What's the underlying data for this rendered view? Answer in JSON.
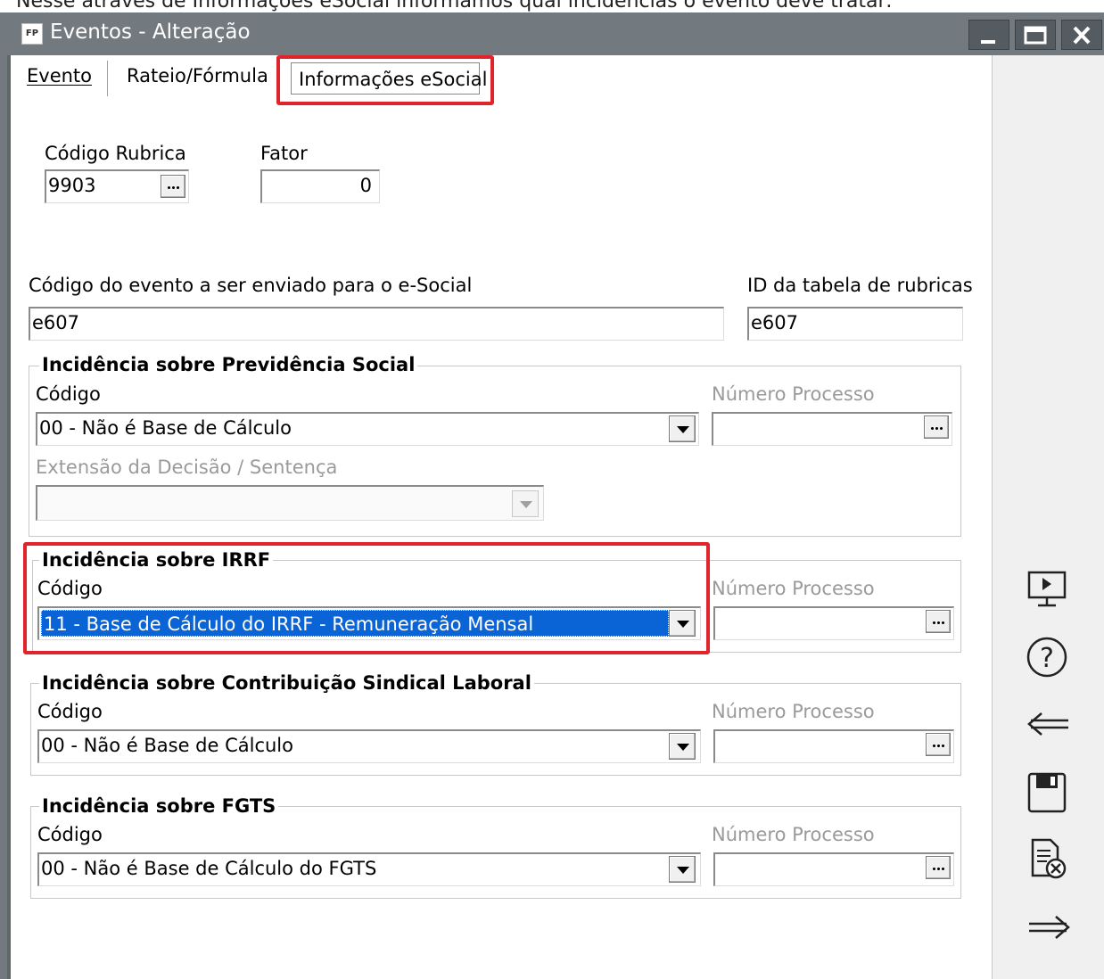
{
  "window": {
    "title": "Eventos - Alteração",
    "app_icon_text": "FP",
    "top_caption": "Nesse através de Informações eSocial informamos qual incidências o evento deve tratar:"
  },
  "tabs": [
    {
      "label": "Evento",
      "underline": "E"
    },
    {
      "label": "Rateio/Fórmula"
    },
    {
      "label": "Informações eSocial",
      "active": true
    }
  ],
  "rubrica": {
    "label": "Código Rubrica",
    "value": "9903"
  },
  "fator": {
    "label": "Fator",
    "value": "0"
  },
  "codigo_evento": {
    "label": "Código do evento a ser enviado para o e-Social",
    "value": "e607"
  },
  "id_tabela": {
    "label": "ID da tabela de rubricas",
    "value": "e607"
  },
  "groups": {
    "previdencia": {
      "title": "Incidência sobre Previdência Social",
      "codigo_label": "Código",
      "codigo_value": "00 - Não é Base de Cálculo",
      "processo_label": "Número Processo",
      "processo_value": "",
      "extensao_label": "Extensão da Decisão / Sentença",
      "extensao_value": ""
    },
    "irrf": {
      "title": "Incidência sobre IRRF",
      "codigo_label": "Código",
      "codigo_value": "11 - Base de Cálculo do IRRF - Remuneração Mensal",
      "processo_label": "Número Processo",
      "processo_value": ""
    },
    "sindical": {
      "title": "Incidência sobre Contribuição Sindical Laboral",
      "codigo_label": "Código",
      "codigo_value": "00 - Não é Base de Cálculo",
      "processo_label": "Número Processo",
      "processo_value": ""
    },
    "fgts": {
      "title": "Incidência sobre FGTS",
      "codigo_label": "Código",
      "codigo_value": "00 - Não é Base de Cálculo do FGTS",
      "processo_label": "Número Processo",
      "processo_value": ""
    }
  },
  "side_icons": [
    "presentation-icon",
    "help-icon",
    "back-arrow-icon",
    "save-icon",
    "cancel-document-icon",
    "forward-arrow-icon"
  ],
  "colors": {
    "titlebar": "#737a7f",
    "highlight": "#e0242b",
    "selection": "#0a64d6"
  }
}
